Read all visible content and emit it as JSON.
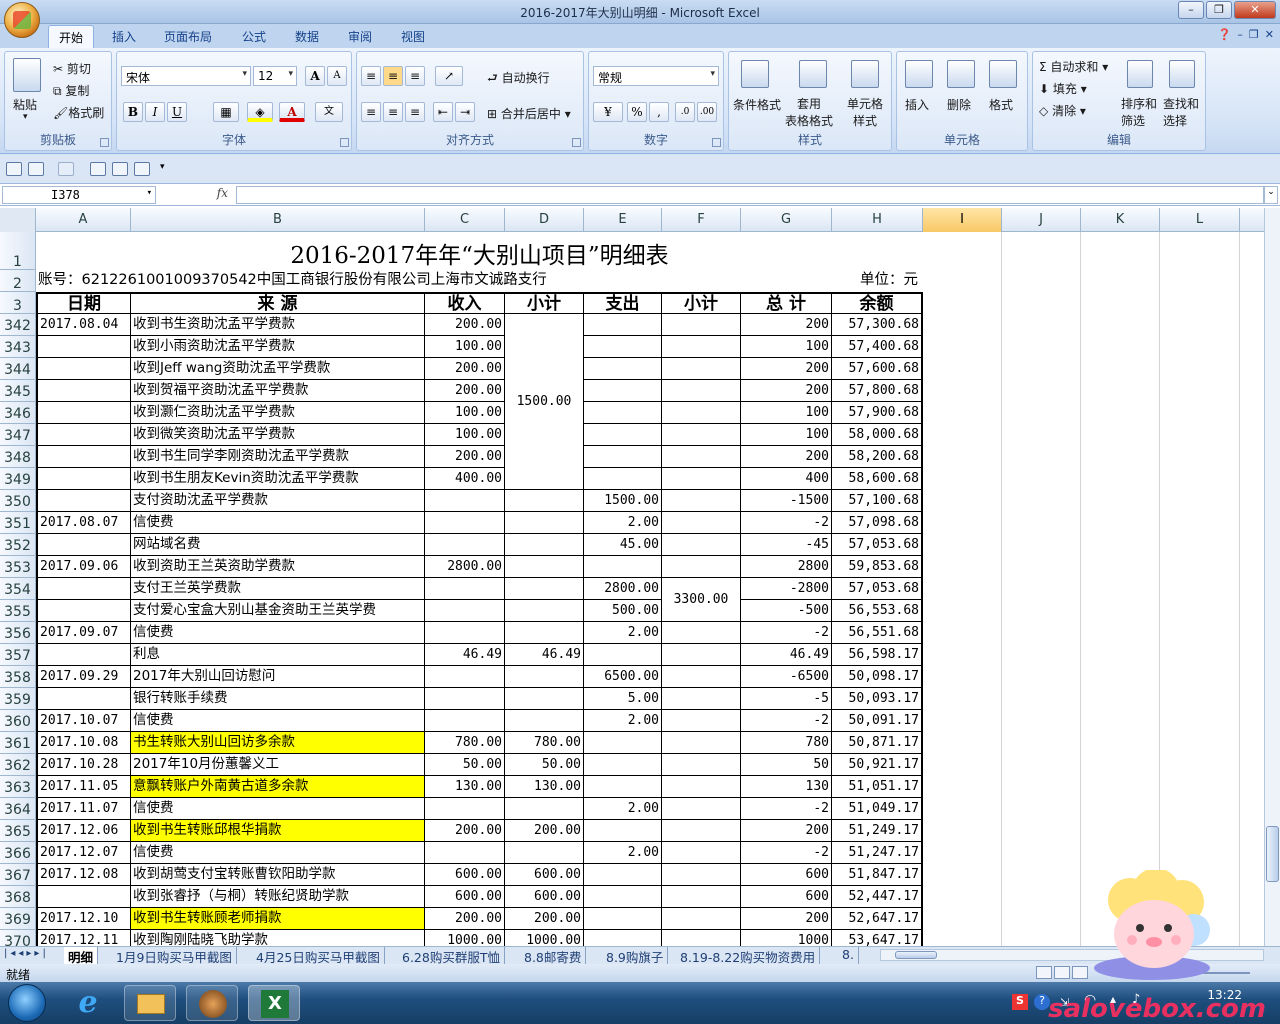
{
  "window": {
    "title": "2016-2017年大别山明细 - Microsoft Excel"
  },
  "tabs": [
    "开始",
    "插入",
    "页面布局",
    "公式",
    "数据",
    "审阅",
    "视图"
  ],
  "ribbon": {
    "clipboard": {
      "paste": "粘贴",
      "cut": "剪切",
      "copy": "复制",
      "format_painter": "格式刷",
      "label": "剪贴板"
    },
    "font": {
      "name": "宋体",
      "size": "12",
      "bold": "B",
      "italic": "I",
      "underline": "U",
      "grow": "A",
      "shrink": "A",
      "label": "字体"
    },
    "alignment": {
      "wrap": "自动换行",
      "merge": "合并后居中",
      "label": "对齐方式"
    },
    "number": {
      "format": "常规",
      "percent": "%",
      "comma": ",",
      "label": "数字"
    },
    "styles": {
      "conditional": "条件格式",
      "table": "套用\n表格格式",
      "cell": "单元格\n样式",
      "label": "样式"
    },
    "cells": {
      "insert": "插入",
      "delete": "删除",
      "format": "格式",
      "label": "单元格"
    },
    "editing": {
      "autosum": "自动求和",
      "fill": "填充",
      "clear": "清除",
      "sort": "排序和\n筛选",
      "find": "查找和\n选择",
      "label": "编辑"
    }
  },
  "namebox": "I378",
  "fx": "fx",
  "columns": [
    "A",
    "B",
    "C",
    "D",
    "E",
    "F",
    "G",
    "H",
    "I",
    "J",
    "K",
    "L"
  ],
  "sheet": {
    "title": "2016-2017年年“大别山项目”明细表",
    "account": "账号：6212261001009370542中国工商银行股份有限公司上海市文诚路支行",
    "unit": "单位：元",
    "headers": [
      "日期",
      "来 源",
      "收入",
      "小计",
      "支出",
      "小计",
      "总 计",
      "余额"
    ],
    "header_rows": [
      "1",
      "2",
      "3"
    ],
    "rows": [
      {
        "n": "342",
        "a": "2017.08.04",
        "b": "收到书生资助沈孟平学费款",
        "c": "200.00",
        "e": "",
        "g": "200",
        "h": "57,300.68"
      },
      {
        "n": "343",
        "a": "",
        "b": "收到小雨资助沈孟平学费款",
        "c": "100.00",
        "e": "",
        "g": "100",
        "h": "57,400.68"
      },
      {
        "n": "344",
        "a": "",
        "b": "收到Jeff wang资助沈孟平学费款",
        "c": "200.00",
        "e": "",
        "g": "200",
        "h": "57,600.68"
      },
      {
        "n": "345",
        "a": "",
        "b": "收到贺福平资助沈孟平学费款",
        "c": "200.00",
        "e": "",
        "g": "200",
        "h": "57,800.68"
      },
      {
        "n": "346",
        "a": "",
        "b": "收到灏仁资助沈孟平学费款",
        "c": "100.00",
        "e": "",
        "g": "100",
        "h": "57,900.68"
      },
      {
        "n": "347",
        "a": "",
        "b": "收到微笑资助沈孟平学费款",
        "c": "100.00",
        "e": "",
        "g": "100",
        "h": "58,000.68"
      },
      {
        "n": "348",
        "a": "",
        "b": "收到书生同学李刚资助沈孟平学费款",
        "c": "200.00",
        "e": "",
        "g": "200",
        "h": "58,200.68"
      },
      {
        "n": "349",
        "a": "",
        "b": "收到书生朋友Kevin资助沈孟平学费款",
        "c": "400.00",
        "e": "",
        "g": "400",
        "h": "58,600.68"
      },
      {
        "n": "350",
        "a": "",
        "b": "支付资助沈孟平学费款",
        "c": "",
        "e": "1500.00",
        "g": "-1500",
        "h": "57,100.68"
      },
      {
        "n": "351",
        "a": "2017.08.07",
        "b": "信使费",
        "c": "",
        "e": "2.00",
        "g": "-2",
        "h": "57,098.68"
      },
      {
        "n": "352",
        "a": "",
        "b": "网站域名费",
        "c": "",
        "e": "45.00",
        "g": "-45",
        "h": "57,053.68"
      },
      {
        "n": "353",
        "a": "2017.09.06",
        "b": "收到资助王兰英资助学费款",
        "c": "2800.00",
        "e": "",
        "g": "2800",
        "h": "59,853.68"
      },
      {
        "n": "354",
        "a": "",
        "b": "支付王兰英学费款",
        "c": "",
        "e": "2800.00",
        "g": "-2800",
        "h": "57,053.68"
      },
      {
        "n": "355",
        "a": "",
        "b": "支付爱心宝盒大别山基金资助王兰英学费",
        "c": "",
        "e": "500.00",
        "g": "-500",
        "h": "56,553.68"
      },
      {
        "n": "356",
        "a": "2017.09.07",
        "b": "信使费",
        "c": "",
        "e": "2.00",
        "g": "-2",
        "h": "56,551.68"
      },
      {
        "n": "357",
        "a": "",
        "b": "利息",
        "c": "46.49",
        "d": "46.49",
        "e": "",
        "g": "46.49",
        "h": "56,598.17"
      },
      {
        "n": "358",
        "a": "2017.09.29",
        "b": "2017年大别山回访慰问",
        "c": "",
        "e": "6500.00",
        "g": "-6500",
        "h": "50,098.17"
      },
      {
        "n": "359",
        "a": "",
        "b": "银行转账手续费",
        "c": "",
        "e": "5.00",
        "g": "-5",
        "h": "50,093.17"
      },
      {
        "n": "360",
        "a": "2017.10.07",
        "b": "信使费",
        "c": "",
        "e": "2.00",
        "g": "-2",
        "h": "50,091.17"
      },
      {
        "n": "361",
        "a": "2017.10.08",
        "b": "书生转账大别山回访多余款",
        "c": "780.00",
        "d": "780.00",
        "e": "",
        "g": "780",
        "h": "50,871.17",
        "y": true
      },
      {
        "n": "362",
        "a": "2017.10.28",
        "b": "2017年10月份蕙馨义工",
        "c": "50.00",
        "d": "50.00",
        "e": "",
        "g": "50",
        "h": "50,921.17"
      },
      {
        "n": "363",
        "a": "2017.11.05",
        "b": "意飘转账户外南黄古道多余款",
        "c": "130.00",
        "d": "130.00",
        "e": "",
        "g": "130",
        "h": "51,051.17",
        "y": true
      },
      {
        "n": "364",
        "a": "2017.11.07",
        "b": "信使费",
        "c": "",
        "e": "2.00",
        "g": "-2",
        "h": "51,049.17"
      },
      {
        "n": "365",
        "a": "2017.12.06",
        "b": "收到书生转账邱根华捐款",
        "c": "200.00",
        "d": "200.00",
        "e": "",
        "g": "200",
        "h": "51,249.17",
        "y": true
      },
      {
        "n": "366",
        "a": "2017.12.07",
        "b": "信使费",
        "c": "",
        "e": "2.00",
        "g": "-2",
        "h": "51,247.17"
      },
      {
        "n": "367",
        "a": "2017.12.08",
        "b": "收到胡莺支付宝转账曹钦阳助学款",
        "c": "600.00",
        "d": "600.00",
        "e": "",
        "g": "600",
        "h": "51,847.17"
      },
      {
        "n": "368",
        "a": "",
        "b": "收到张睿抒（与桐）转账纪贤助学款",
        "c": "600.00",
        "d": "600.00",
        "e": "",
        "g": "600",
        "h": "52,447.17"
      },
      {
        "n": "369",
        "a": "2017.12.10",
        "b": "收到书生转账顾老师捐款",
        "c": "200.00",
        "d": "200.00",
        "e": "",
        "g": "200",
        "h": "52,647.17",
        "y": true
      },
      {
        "n": "370",
        "a": "2017.12.11",
        "b": "收到陶刚陆晓飞助学款",
        "c": "1000.00",
        "d": "1000.00",
        "e": "",
        "g": "1000",
        "h": "53,647.17"
      }
    ],
    "merged": {
      "d342_349": "1500.00",
      "f354_355": "3300.00"
    }
  },
  "sheet_tabs": [
    "明细",
    "1月9日购买马甲截图",
    "4月25日购买马甲截图",
    "6.28购买群服T恤",
    "8.8邮寄费",
    "8.9购旗子",
    "8.19-8.22购买物资费用",
    "8."
  ],
  "status": "就绪",
  "clock": "13:22",
  "watermark": "salovebox.com"
}
